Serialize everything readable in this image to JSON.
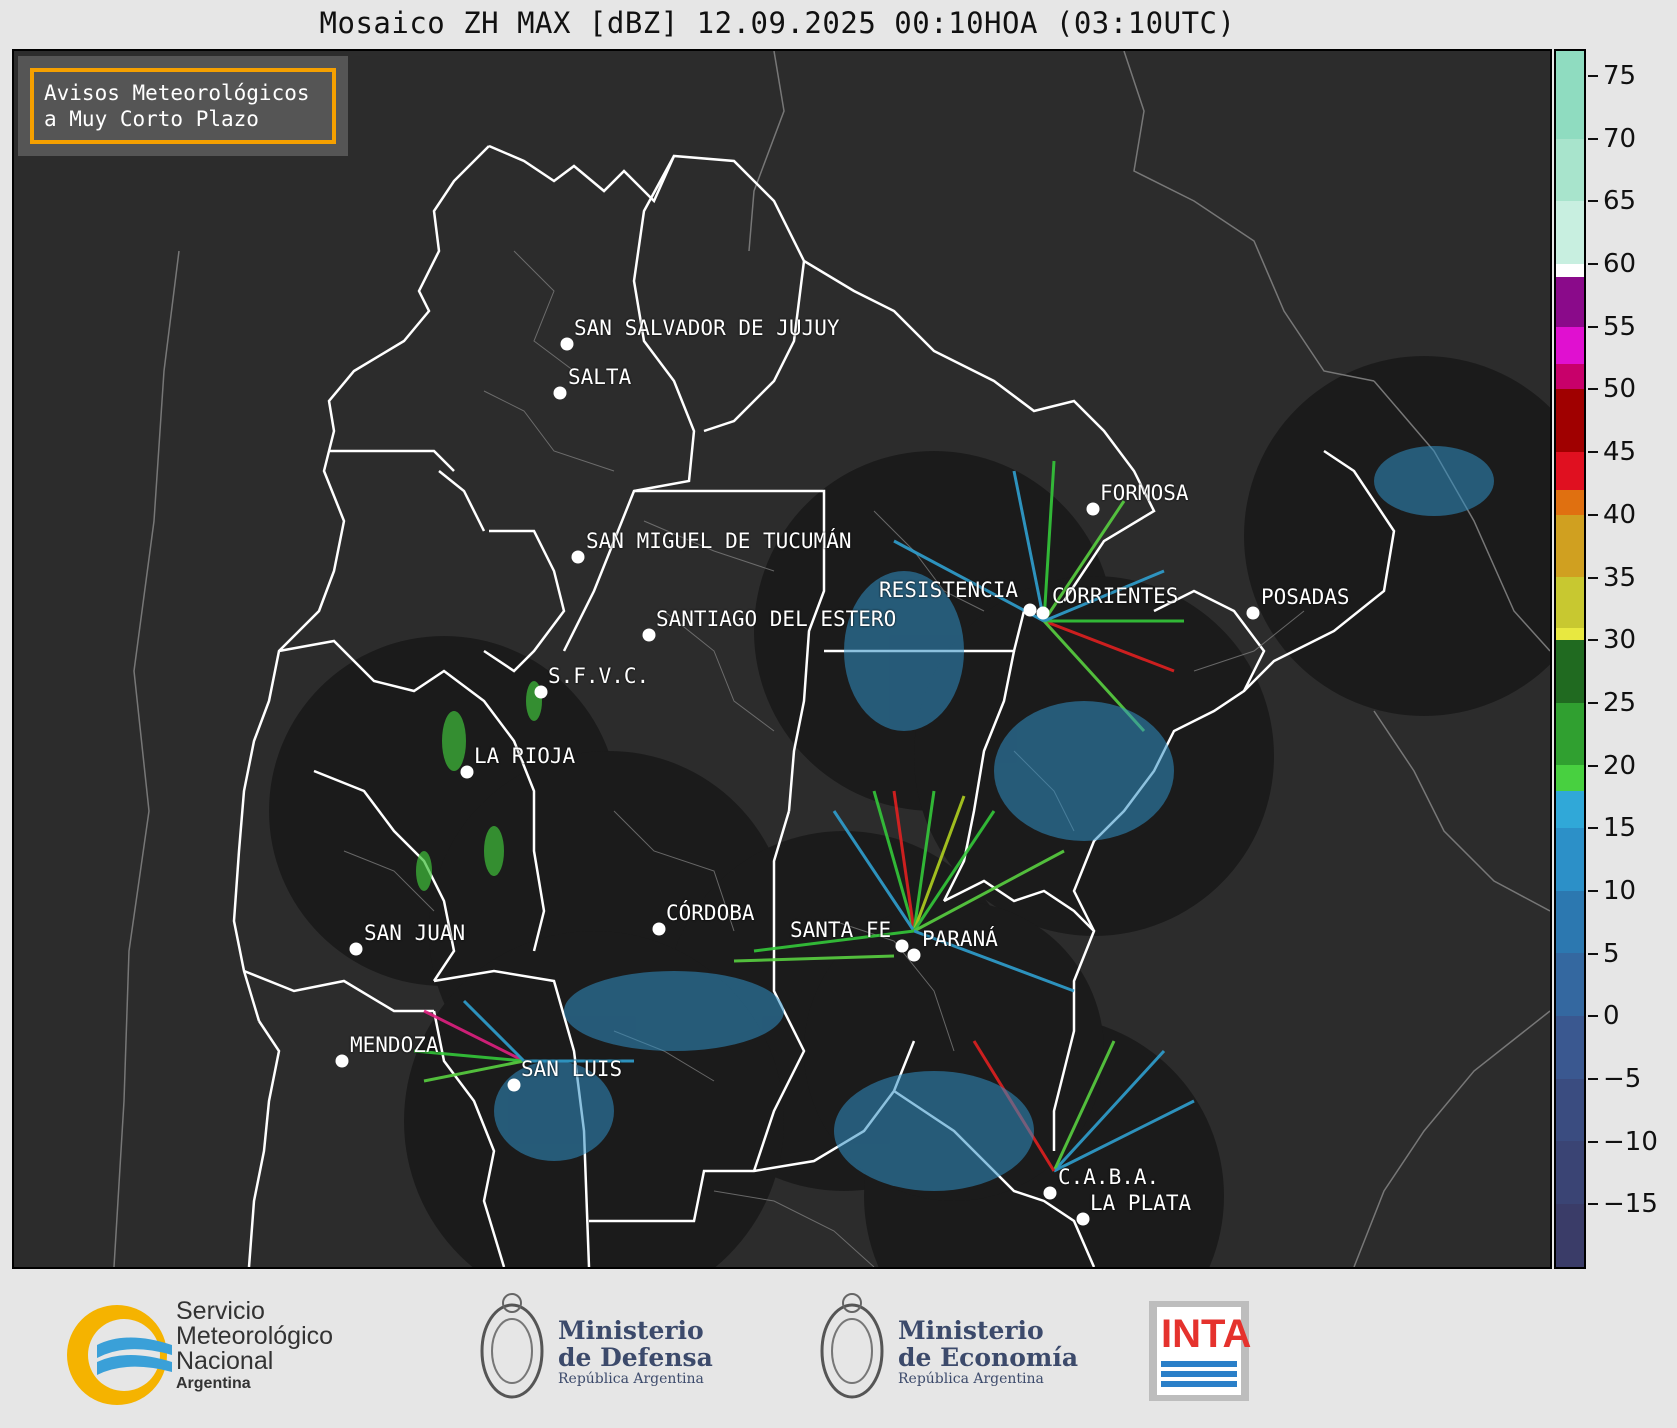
{
  "title": "Mosaico ZH MAX [dBZ] 12.09.2025 00:10HOA (03:10UTC)",
  "badge": {
    "line1": "Avisos Meteorológicos",
    "line2": "a Muy Corto Plazo",
    "border_color": "#f5a000"
  },
  "cities": [
    {
      "name": "SAN SALVADOR DE JUJUY"
    },
    {
      "name": "SALTA"
    },
    {
      "name": "FORMOSA"
    },
    {
      "name": "SAN MIGUEL DE TUCUMÁN"
    },
    {
      "name": "RESISTENCIA"
    },
    {
      "name": "CORRIENTES"
    },
    {
      "name": "POSADAS"
    },
    {
      "name": "SANTIAGO DEL ESTERO"
    },
    {
      "name": "S.F.V.C."
    },
    {
      "name": "LA RIOJA"
    },
    {
      "name": "CÓRDOBA"
    },
    {
      "name": "SANTA FE"
    },
    {
      "name": "PARANÁ"
    },
    {
      "name": "SAN JUAN"
    },
    {
      "name": "MENDOZA"
    },
    {
      "name": "SAN LUIS"
    },
    {
      "name": "C.A.B.A."
    },
    {
      "name": "LA PLATA"
    }
  ],
  "colorbar": {
    "unit": "dBZ",
    "min": -20,
    "max": 77,
    "ticks": [
      "75",
      "70",
      "65",
      "60",
      "55",
      "50",
      "45",
      "40",
      "35",
      "30",
      "25",
      "20",
      "15",
      "10",
      "5",
      "0",
      "−5",
      "−10",
      "−15"
    ],
    "tick_values": [
      75,
      70,
      65,
      60,
      55,
      50,
      45,
      40,
      35,
      30,
      25,
      20,
      15,
      10,
      5,
      0,
      -5,
      -10,
      -15
    ]
  },
  "logos": {
    "smn": {
      "line1": "Servicio",
      "line2": "Meteorológico",
      "line3": "Nacional",
      "line4": "Argentina"
    },
    "defensa": {
      "line1": "Ministerio",
      "line2": "de Defensa",
      "line3": "República Argentina"
    },
    "economia": {
      "line1": "Ministerio",
      "line2": "de Economía",
      "line3": "República Argentina"
    },
    "inta": {
      "label": "INTA"
    }
  }
}
